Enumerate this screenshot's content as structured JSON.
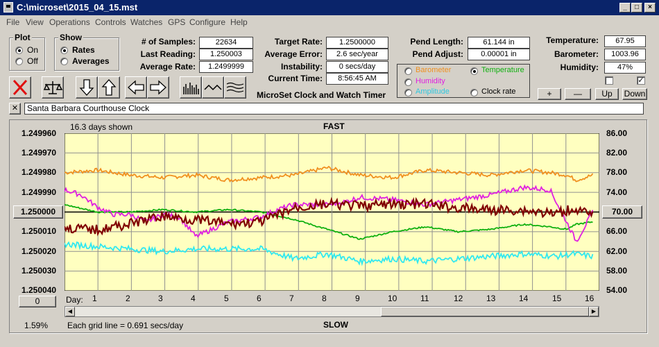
{
  "window": {
    "title": "C:\\microset\\2015_04_15.mst"
  },
  "menu": [
    "File",
    "View",
    "Operations",
    "Controls",
    "Watches",
    "GPS",
    "Configure",
    "Help"
  ],
  "plot_group": {
    "title": "Plot",
    "on": "On",
    "off": "Off",
    "selected": "On"
  },
  "show_group": {
    "title": "Show",
    "rates": "Rates",
    "averages": "Averages",
    "selected": "Rates"
  },
  "stats": {
    "samples_label": "# of Samples:",
    "samples_value": "22634",
    "last_label": "Last Reading:",
    "last_value": "1.250003",
    "avg_label": "Average Rate:",
    "avg_value": "1.2499999",
    "target_label": "Target Rate:",
    "target_value": "1.2500000",
    "error_label": "Average Error:",
    "error_value": "2.6 sec/year",
    "instab_label": "Instability:",
    "instab_value": "0 secs/day",
    "time_label": "Current Time:",
    "time_value": "8:56:45 AM",
    "app_title": "MicroSet Clock and Watch Timer",
    "pendlen_label": "Pend Length:",
    "pendlen_value": "61.144 in",
    "pendadj_label": "Pend Adjust:",
    "pendadj_value": "0.00001 in",
    "temp_label": "Temperature:",
    "temp_value": "67.95",
    "baro_label": "Barometer:",
    "baro_value": "1003.96",
    "hum_label": "Humidity:",
    "hum_value": "47%"
  },
  "overlay": {
    "barometer": "Barometer",
    "temperature": "Temperature",
    "humidity": "Humidity",
    "amplitude": "Amplitude",
    "clock_rate": "Clock rate",
    "selected": "Temperature"
  },
  "sensor_buttons": {
    "plus": "+",
    "minus": "—",
    "up": "Up",
    "down": "Down"
  },
  "description": {
    "close": "✕",
    "text": "Santa Barbara Courthouse Clock"
  },
  "plot": {
    "days_shown": "16.3 days shown",
    "top_label": "FAST",
    "bottom_label": "SLOW",
    "grid_note": "Each grid line = 0.691 secs/day",
    "percent": "1.59%",
    "center_left": "1.250000",
    "center_right": "70.00",
    "offset_button": "0",
    "day_label": "Day:",
    "left_ticks": [
      "1.249960",
      "1.249970",
      "1.249980",
      "1.249990",
      "",
      "1.250010",
      "1.250020",
      "1.250030",
      "1.250040"
    ],
    "right_ticks": [
      "86.00",
      "82.00",
      "78.00",
      "74.00",
      "",
      "66.00",
      "62.00",
      "58.00",
      "54.00"
    ],
    "day_ticks": [
      "1",
      "2",
      "3",
      "4",
      "5",
      "6",
      "7",
      "8",
      "9",
      "10",
      "11",
      "12",
      "13",
      "14",
      "15",
      "16"
    ]
  },
  "colors": {
    "plot_bg": "#ffffc0",
    "barometer": "#f09020",
    "temperature": "#10b010",
    "humidity": "#e020e0",
    "amplitude": "#30e8f0",
    "rate": "#800000"
  },
  "chart_data": {
    "type": "line",
    "xlabel": "Day:",
    "xlim": [
      0,
      16.3
    ],
    "ylim_left": [
      1.25004,
      1.24996
    ],
    "ylim_right": [
      54,
      86
    ],
    "series": [
      {
        "name": "Barometer",
        "axis": "right",
        "x": [
          0,
          1,
          2,
          3,
          4,
          5,
          6,
          7,
          8,
          9,
          10,
          11,
          12,
          13,
          14,
          14.8,
          15.3,
          15.6,
          16.1
        ],
        "y": [
          78.0,
          78.5,
          77.5,
          77.0,
          77.5,
          76.5,
          77.0,
          77.5,
          79.0,
          77.5,
          77.0,
          78.5,
          78.0,
          77.5,
          78.5,
          78.0,
          77.5,
          76.5,
          77.5
        ]
      },
      {
        "name": "Temperature",
        "axis": "right",
        "x": [
          0,
          1,
          2,
          3,
          4,
          5,
          6,
          7,
          8,
          9,
          10,
          11,
          12,
          13,
          14,
          14.8,
          15.3,
          15.6,
          16.1
        ],
        "y": [
          71.5,
          70.0,
          70.0,
          70.5,
          70.0,
          70.5,
          70.0,
          68.5,
          66.5,
          64.5,
          66.0,
          67.0,
          66.0,
          66.5,
          67.5,
          67.0,
          66.5,
          67.5,
          68.0
        ]
      },
      {
        "name": "Humidity",
        "axis": "right",
        "x": [
          0,
          0.5,
          1,
          1.5,
          2,
          2.5,
          3,
          3.5,
          4,
          5,
          6,
          6.5,
          7,
          8,
          8.5,
          9,
          10,
          11,
          12,
          13,
          14,
          14.8,
          15.3,
          15.6,
          16.1
        ],
        "y": [
          74.5,
          73.5,
          71.0,
          69.5,
          69.5,
          68.0,
          69.5,
          69.0,
          65.0,
          68.0,
          69.0,
          70.5,
          71.5,
          71.5,
          72.0,
          73.0,
          72.5,
          71.5,
          72.5,
          73.5,
          75.0,
          74.5,
          68.0,
          64.0,
          70.0
        ]
      },
      {
        "name": "Amplitude",
        "axis": "right",
        "x": [
          0,
          1,
          2,
          3,
          4,
          5,
          6,
          7,
          8,
          9,
          10,
          11,
          12,
          13,
          14,
          15,
          15.5,
          16.1
        ],
        "y": [
          63.5,
          63.0,
          62.5,
          62.0,
          62.5,
          62.5,
          62.5,
          60.5,
          61.5,
          60.0,
          60.5,
          60.0,
          60.5,
          61.0,
          61.5,
          61.0,
          61.5,
          61.0
        ]
      },
      {
        "name": "Clock rate",
        "axis": "left",
        "x": [
          0,
          1,
          2,
          3,
          4,
          5,
          6,
          7,
          8,
          9,
          10,
          11,
          12,
          13,
          14,
          15,
          15.5,
          16.1
        ],
        "y": [
          1.250008,
          1.250009,
          1.250006,
          1.250002,
          1.250004,
          1.250006,
          1.250005,
          1.249998,
          1.249996,
          1.249997,
          1.249996,
          1.249996,
          1.249998,
          1.249999,
          1.249999,
          1.250001,
          1.249998,
          1.250002
        ]
      }
    ]
  }
}
